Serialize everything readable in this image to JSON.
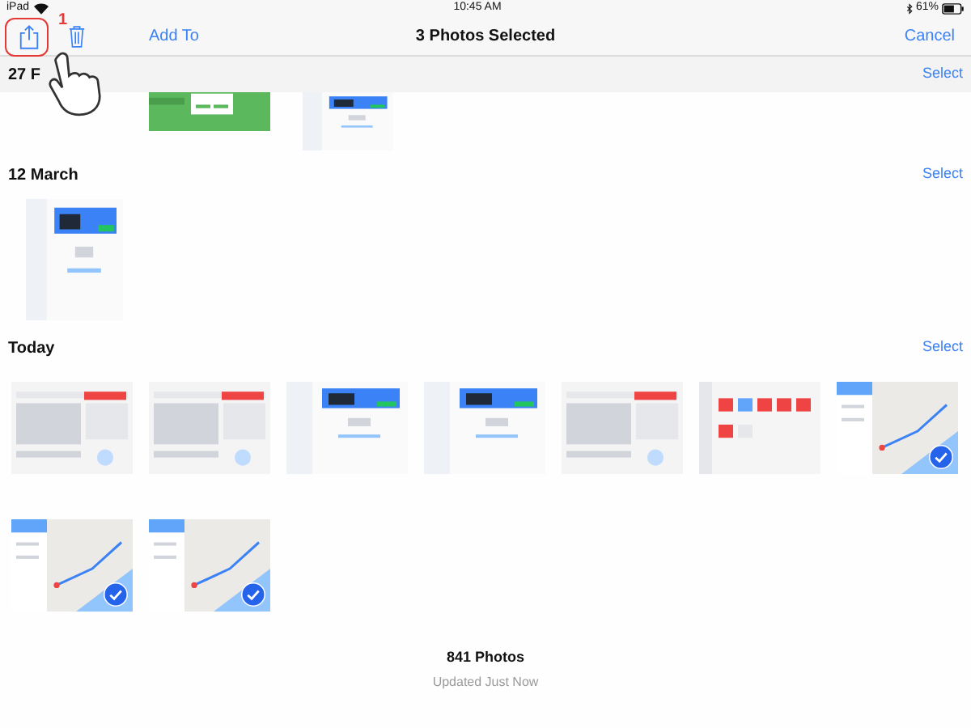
{
  "status_bar": {
    "device": "iPad",
    "time": "10:45 AM",
    "battery": "61%"
  },
  "toolbar": {
    "add_to": "Add To",
    "title": "3 Photos Selected",
    "cancel": "Cancel"
  },
  "annotation": {
    "label": "1"
  },
  "sections": [
    {
      "title": "27 F",
      "action": "Select",
      "photos": [
        {
          "selected": false
        },
        {
          "selected": false
        }
      ]
    },
    {
      "title": "12 March",
      "action": "Select",
      "photos": [
        {
          "selected": false
        }
      ]
    },
    {
      "title": "Today",
      "action": "Select",
      "photos": [
        {
          "selected": false
        },
        {
          "selected": false
        },
        {
          "selected": false
        },
        {
          "selected": false
        },
        {
          "selected": false
        },
        {
          "selected": false
        },
        {
          "selected": true
        },
        {
          "selected": true
        },
        {
          "selected": true
        }
      ]
    }
  ],
  "footer": {
    "count": "841 Photos",
    "status": "Updated Just Now"
  }
}
